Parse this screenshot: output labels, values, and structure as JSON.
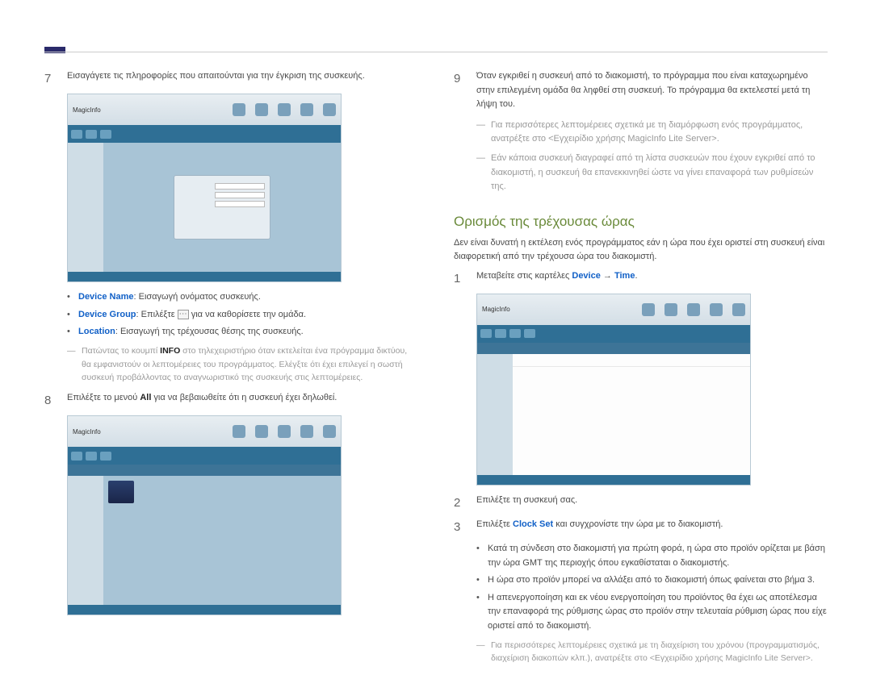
{
  "left": {
    "step7": "Εισαγάγετε τις πληροφορίες που απαιτούνται για την έγκριση της συσκευής.",
    "bullets": {
      "device_name_label": "Device Name",
      "device_name_text": ": Εισαγωγή ονόματος συσκευής.",
      "device_group_label": "Device Group",
      "device_group_text1": ": Επιλέξτε ",
      "device_group_text2": " για να καθορίσετε την ομάδα.",
      "location_label": "Location",
      "location_text": ": Εισαγωγή της τρέχουσας θέσης της συσκευής."
    },
    "dash_info_a": "Πατώντας το κουμπί ",
    "dash_info_b": "INFO",
    "dash_info_c": " στο τηλεχειριστήριο όταν εκτελείται ένα πρόγραμμα δικτύου, θα εμφανιστούν οι λεπτομέρειες του προγράμματος. Ελέγξτε ότι έχει επιλεγεί η σωστή συσκευή προβάλλοντας το αναγνωριστικό της συσκευής στις λεπτομέρειες.",
    "step8_a": "Επιλέξτε το μενού ",
    "step8_b": "All",
    "step8_c": " για να βεβαιωθείτε ότι η συσκευή έχει δηλωθεί.",
    "shot_logo": "MagicInfo"
  },
  "right": {
    "step9": "Όταν εγκριθεί η συσκευή από το διακομιστή, το πρόγραμμα που είναι καταχωρημένο στην επιλεγμένη ομάδα θα ληφθεί στη συσκευή. Το πρόγραμμα θα εκτελεστεί μετά τη λήψη του.",
    "dash1": "Για περισσότερες λεπτομέρειες σχετικά με τη διαμόρφωση ενός προγράμματος, ανατρέξτε στο <Εγχειρίδιο χρήσης MagicInfo Lite Server>.",
    "dash2": "Εάν κάποια συσκευή διαγραφεί από τη λίστα συσκευών που έχουν εγκριθεί από το διακομιστή, η συσκευή θα επανεκκινηθεί ώστε να γίνει επαναφορά των ρυθμίσεών της.",
    "section_title": "Ορισμός της τρέχουσας ώρας",
    "section_intro": "Δεν είναι δυνατή η εκτέλεση ενός προγράμματος εάν η ώρα που έχει οριστεί στη συσκευή είναι διαφορετική από την τρέχουσα ώρα του διακομιστή.",
    "step1_a": "Μεταβείτε στις καρτέλες ",
    "step1_b": "Device",
    "step1_arrow": " → ",
    "step1_c": "Time",
    "step1_d": ".",
    "step2": "Επιλέξτε τη συσκευή σας.",
    "step3_a": "Επιλέξτε ",
    "step3_b": "Clock Set",
    "step3_c": " και συγχρονίστε την ώρα με το διακομιστή.",
    "bullets": {
      "b1": "Κατά τη σύνδεση στο διακομιστή για πρώτη φορά, η ώρα στο προϊόν ορίζεται με βάση την ώρα GMT της περιοχής όπου εγκαθίσταται ο διακομιστής.",
      "b2": "Η ώρα στο προϊόν μπορεί να αλλάξει από το διακομιστή όπως φαίνεται στο βήμα 3.",
      "b3": "Η απενεργοποίηση και εκ νέου ενεργοποίηση του προϊόντος θα έχει ως αποτέλεσμα την επαναφορά της ρύθμισης ώρας στο προϊόν στην τελευταία ρύθμιση ώρας που είχε οριστεί από το διακομιστή."
    },
    "dash3": "Για περισσότερες λεπτομέρειες σχετικά με τη διαχείριση του χρόνου (προγραμματισμός, διαχείριση διακοπών κλπ.), ανατρέξτε στο <Εγχειρίδιο χρήσης MagicInfo Lite Server>.",
    "shot_logo": "MagicInfo"
  }
}
